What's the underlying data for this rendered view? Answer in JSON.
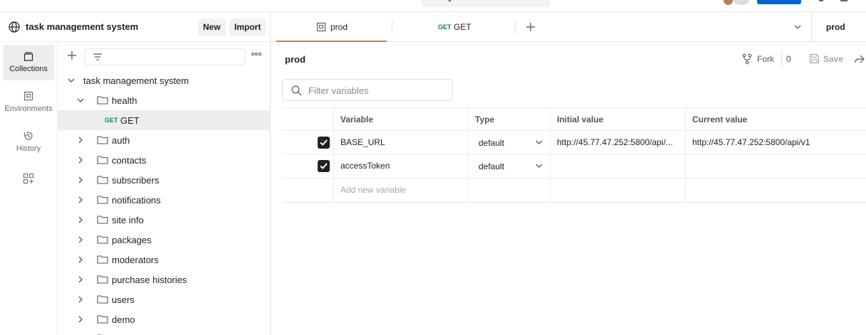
{
  "workspace": {
    "title": "task management system",
    "new_label": "New",
    "import_label": "Import"
  },
  "rail": {
    "items": [
      {
        "label": "Collections",
        "icon": "collections-icon",
        "active": true
      },
      {
        "label": "Environments",
        "icon": "environments-icon",
        "active": false
      },
      {
        "label": "History",
        "icon": "history-icon",
        "active": false
      },
      {
        "label": "",
        "icon": "configure-workbench-icon",
        "active": false
      }
    ]
  },
  "tree": {
    "root": "task management system",
    "items": [
      {
        "label": "health",
        "type": "folder",
        "expanded": true
      },
      {
        "label": "GET",
        "type": "request",
        "method": "GET",
        "selected": true
      },
      {
        "label": "auth",
        "type": "folder",
        "expanded": false
      },
      {
        "label": "contacts",
        "type": "folder",
        "expanded": false
      },
      {
        "label": "subscribers",
        "type": "folder",
        "expanded": false
      },
      {
        "label": "notifications",
        "type": "folder",
        "expanded": false
      },
      {
        "label": "site info",
        "type": "folder",
        "expanded": false
      },
      {
        "label": "packages",
        "type": "folder",
        "expanded": false
      },
      {
        "label": "moderators",
        "type": "folder",
        "expanded": false
      },
      {
        "label": "purchase histories",
        "type": "folder",
        "expanded": false
      },
      {
        "label": "users",
        "type": "folder",
        "expanded": false
      },
      {
        "label": "demo",
        "type": "folder",
        "expanded": false
      }
    ]
  },
  "tabs": [
    {
      "label": "prod",
      "type": "environment",
      "active": true
    },
    {
      "label": "GET",
      "method": "GET",
      "type": "request",
      "active": false
    }
  ],
  "environment_selector": {
    "current": "prod"
  },
  "env": {
    "title": "prod",
    "fork_label": "Fork",
    "fork_count": "0",
    "save_label": "Save",
    "filter_placeholder": "Filter variables",
    "columns": [
      "Variable",
      "Type",
      "Initial value",
      "Current value"
    ],
    "variables": [
      {
        "enabled": true,
        "name": "BASE_URL",
        "type": "default",
        "initial_value": "http://45.77.47.252:5800/api/...",
        "current_value": "http://45.77.47.252:5800/api/v1"
      },
      {
        "enabled": true,
        "name": "accessToken",
        "type": "default",
        "initial_value": "",
        "current_value": ""
      }
    ],
    "add_placeholder": "Add new variable"
  },
  "colors": {
    "accent": "#ff6c37",
    "get_method": "#0a8c3a",
    "primary_button": "#0265d2"
  }
}
